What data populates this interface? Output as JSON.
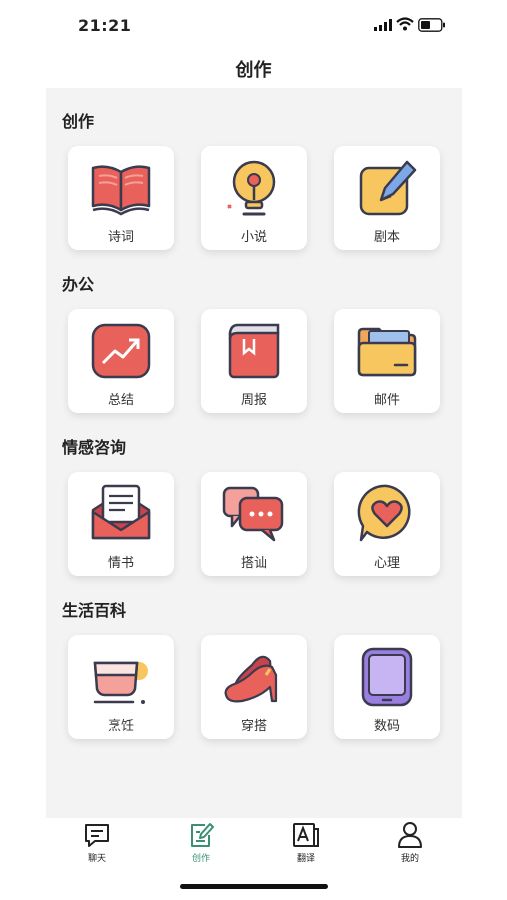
{
  "status_bar": {
    "time": "21:21"
  },
  "header": {
    "title": "创作"
  },
  "sections": [
    {
      "title": "创作",
      "items": [
        {
          "label": "诗词",
          "icon": "book-icon"
        },
        {
          "label": "小说",
          "icon": "lightbulb-icon"
        },
        {
          "label": "剧本",
          "icon": "pencil-note-icon"
        }
      ]
    },
    {
      "title": "办公",
      "items": [
        {
          "label": "总结",
          "icon": "trend-chart-icon"
        },
        {
          "label": "周报",
          "icon": "bookmark-book-icon"
        },
        {
          "label": "邮件",
          "icon": "folder-icon"
        }
      ]
    },
    {
      "title": "情感咨询",
      "items": [
        {
          "label": "情书",
          "icon": "love-letter-icon"
        },
        {
          "label": "搭讪",
          "icon": "chat-bubbles-icon"
        },
        {
          "label": "心理",
          "icon": "heart-bubble-icon"
        }
      ]
    },
    {
      "title": "生活百科",
      "items": [
        {
          "label": "烹饪",
          "icon": "teacup-icon"
        },
        {
          "label": "穿搭",
          "icon": "high-heels-icon"
        },
        {
          "label": "数码",
          "icon": "tablet-icon"
        }
      ]
    }
  ],
  "tabbar": {
    "tabs": [
      {
        "label": "聊天",
        "icon": "chat-icon"
      },
      {
        "label": "创作",
        "icon": "edit-doc-icon",
        "active": true
      },
      {
        "label": "翻译",
        "icon": "translate-icon"
      },
      {
        "label": "我的",
        "icon": "user-icon"
      }
    ]
  },
  "colors": {
    "accent": "#3a8f74",
    "icon_red": "#e8615a",
    "icon_yellow": "#f7c65e",
    "outline": "#3b3b4f"
  }
}
